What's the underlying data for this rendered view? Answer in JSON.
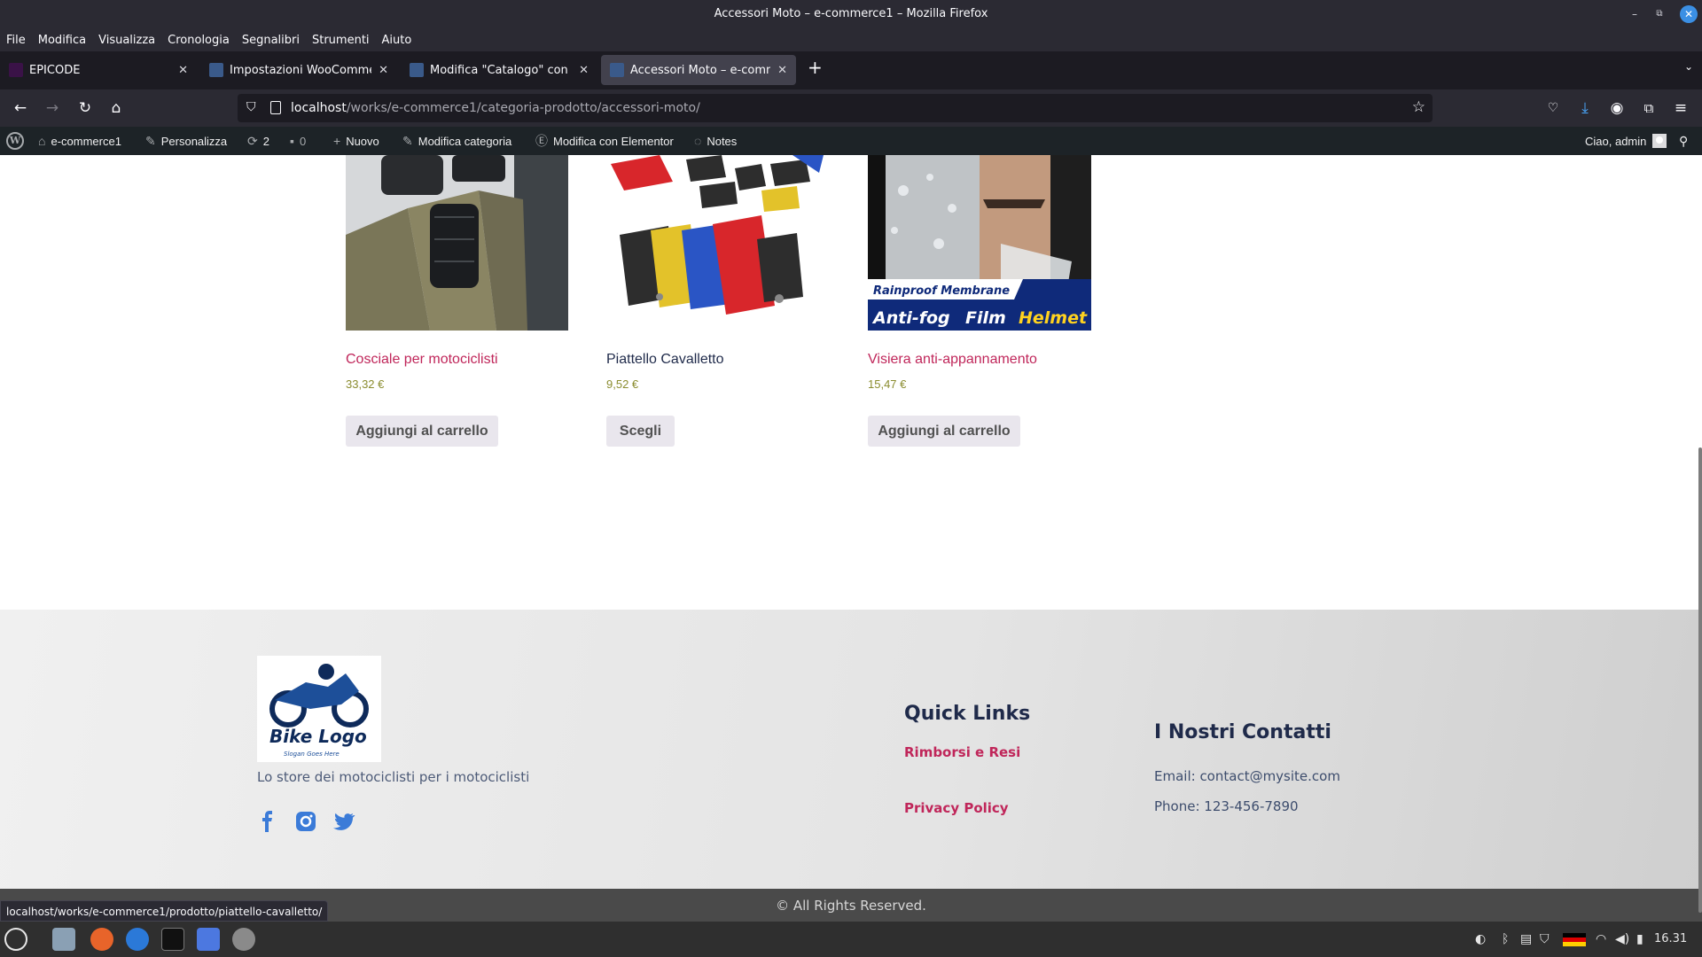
{
  "window": {
    "title": "Accessori Moto – e-commerce1 – Mozilla Firefox"
  },
  "menubar": [
    "File",
    "Modifica",
    "Visualizza",
    "Cronologia",
    "Segnalibri",
    "Strumenti",
    "Aiuto"
  ],
  "tabs": [
    {
      "label": "EPICODE",
      "favicon_color": "#3a1247"
    },
    {
      "label": "Impostazioni WooCommerce",
      "favicon_color": "#3a5a8a"
    },
    {
      "label": "Modifica \"Catalogo\" con Ele",
      "favicon_color": "#3a5a8a"
    },
    {
      "label": "Accessori Moto – e-commer",
      "favicon_color": "#3a5a8a"
    }
  ],
  "urlbar": {
    "host": "localhost",
    "path": "/works/e-commerce1/categoria-prodotto/accessori-moto/"
  },
  "wpbar": {
    "site": "e-commerce1",
    "customize": "Personalizza",
    "updates": "2",
    "comments": "0",
    "new": "Nuovo",
    "edit_category": "Modifica categoria",
    "elementor": "Modifica con Elementor",
    "notes": "Notes",
    "greeting": "Ciao, admin"
  },
  "products": [
    {
      "name": "Cosciale per motociclisti",
      "price": "33,32 €",
      "button": "Aggiungi al carrello",
      "name_color": "#c0265a"
    },
    {
      "name": "Piattello Cavalletto",
      "price": "9,52 €",
      "button": "Scegli",
      "name_color": "#1f2a4a"
    },
    {
      "name": "Visiera anti-appannamento",
      "price": "15,47 €",
      "button": "Aggiungi al carrello",
      "name_color": "#c0265a"
    }
  ],
  "visor_image": {
    "line1": "Rainproof Membrane",
    "line2a": "Anti-fog",
    "line2b": "Film",
    "line2c": "Helmet"
  },
  "footer": {
    "logo_text": "Bike Logo",
    "logo_slogan": "Slogan Goes Here",
    "tagline": "Lo store dei motociclisti per i motociclisti",
    "social": [
      "facebook-icon",
      "instagram-icon",
      "twitter-icon"
    ],
    "quick_links_title": "Quick Links",
    "quick_links": [
      "Rimborsi e Resi",
      "Privacy Policy"
    ],
    "contacts_title": "I Nostri Contatti",
    "email": "Email: contact@mysite.com",
    "phone": "Phone: 123-456-7890",
    "copyright": "© All Rights Reserved."
  },
  "statusbar": {
    "link": "localhost/works/e-commerce1/prodotto/piattello-cavalletto/"
  },
  "taskbar": {
    "clock": "16.31"
  },
  "colors": {
    "accent": "#c0265a",
    "heading": "#1f2a4a",
    "price": "#8a8c2e",
    "social": "#3b7bd8"
  }
}
